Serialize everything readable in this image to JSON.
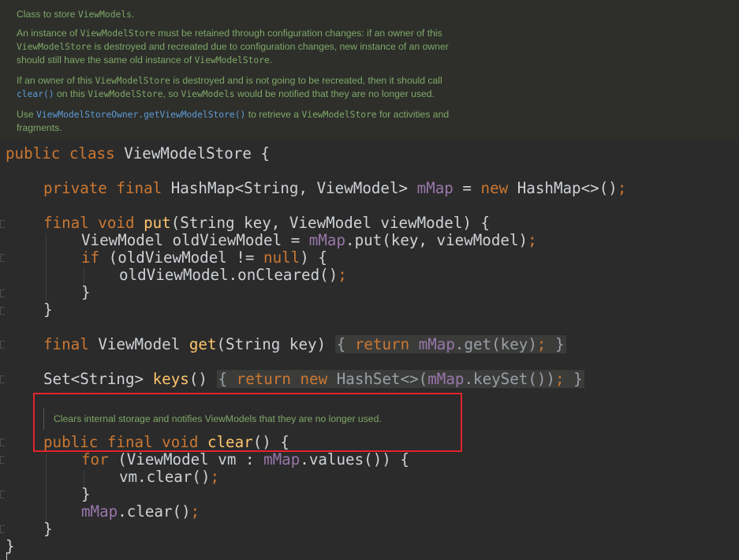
{
  "javadoc": {
    "p1": {
      "a": "Class to store ",
      "b": "ViewModels",
      "c": "."
    },
    "p2": {
      "a": "An instance of ",
      "b": "ViewModelStore",
      "c": " must be retained through configuration changes: if an owner of this",
      "d": "ViewModelStore",
      "e": " is destroyed and recreated due to configuration changes, new instance of an owner",
      "f": "should still have the same old instance of ",
      "g": "ViewModelStore",
      "h": "."
    },
    "p3": {
      "a": "If an owner of this ",
      "b": "ViewModelStore",
      "c": " is destroyed and is not going to be recreated, then it should call",
      "d": "clear()",
      "e": " on this ",
      "f": "ViewModelStore",
      "g": ", so ",
      "h": "ViewModels",
      "i": " would be notified that they are no longer used."
    },
    "p4": {
      "a": "Use ",
      "b": "ViewModelStoreOwner.getViewModelStore()",
      "c": " to retrieve a ",
      "d": "ViewModelStore",
      "e": " for activities and",
      "f": "fragments."
    }
  },
  "code": {
    "l1": {
      "kw": "public class ",
      "rest": "ViewModelStore {"
    },
    "l2": {
      "kw": "private final ",
      "t1": "HashMap<String, ViewModel> ",
      "fld": "mMap",
      "eq": " = ",
      "kw2": "new ",
      "t2": "HashMap<>()",
      "semi": ";"
    },
    "l3": {
      "kw": "final void ",
      "fn": "put",
      "rest": "(String key, ViewModel viewModel) {"
    },
    "l4": {
      "t1": "ViewModel oldViewModel = ",
      "fld": "mMap",
      "t2": ".put(key, viewModel)",
      "semi": ";"
    },
    "l5": {
      "kw": "if ",
      "t1": "(oldViewModel != ",
      "kw2": "null",
      "t2": ") {"
    },
    "l6": {
      "t1": "oldViewModel.onCleared()",
      "semi": ";"
    },
    "l7": {
      "t1": "}"
    },
    "l8": {
      "t1": "}"
    },
    "l9": {
      "kw": "final ",
      "t1": "ViewModel ",
      "fn": "get",
      "t2": "(String key)",
      "fold1": "{",
      "kw2": "return ",
      "fld": "mMap",
      "t3": ".get(key)",
      "semi": ";",
      "fold2": "}"
    },
    "l10": {
      "t1": "Set<String> ",
      "fn": "keys",
      "t2": "()",
      "fold1": "{",
      "kw2": "return new ",
      "t3": "HashSet<>(",
      "fld": "mMap",
      "t4": ".keySet())",
      "semi": ";",
      "fold2": "}"
    },
    "inline_doc": "Clears internal storage and notifies ViewModels that they are no longer used.",
    "l11": {
      "kw": "public final void ",
      "fn": "clear",
      "t1": "() {"
    },
    "l12": {
      "kw": "for ",
      "t1": "(ViewModel vm : ",
      "fld": "mMap",
      "t2": ".values()) {"
    },
    "l13": {
      "t1": "vm.clear()",
      "semi": ";"
    },
    "l14": {
      "t1": "}"
    },
    "l15": {
      "fld": "mMap",
      "t1": ".clear()",
      "semi": ";"
    },
    "l16": {
      "t1": "}"
    },
    "l17": {
      "t1": "}"
    }
  }
}
